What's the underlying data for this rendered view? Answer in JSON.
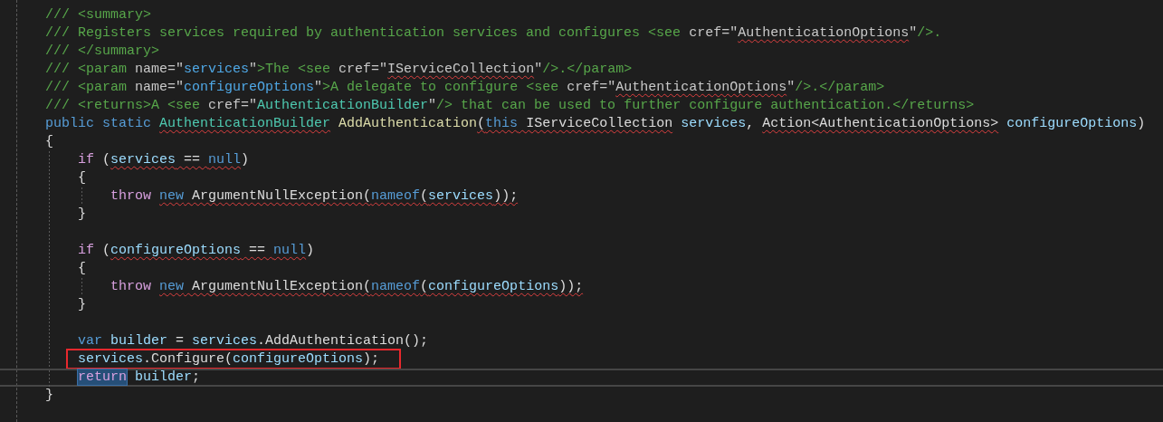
{
  "editor": {
    "lines": [
      {
        "current": false,
        "boxed": false,
        "tokens": [
          {
            "text": "/// <summary>",
            "kind": "comment",
            "error": false,
            "selected": false
          }
        ]
      },
      {
        "current": false,
        "boxed": false,
        "tokens": [
          {
            "text": "/// Registers services required by authentication services and configures <see ",
            "kind": "comment",
            "error": false,
            "selected": false
          },
          {
            "text": "cref=\"",
            "kind": "docattr",
            "error": false,
            "selected": false
          },
          {
            "text": "AuthenticationOptions",
            "kind": "docattr",
            "error": true,
            "selected": false
          },
          {
            "text": "\"",
            "kind": "docattr",
            "error": false,
            "selected": false
          },
          {
            "text": "/>.",
            "kind": "comment",
            "error": false,
            "selected": false
          }
        ]
      },
      {
        "current": false,
        "boxed": false,
        "tokens": [
          {
            "text": "/// </summary>",
            "kind": "comment",
            "error": false,
            "selected": false
          }
        ]
      },
      {
        "current": false,
        "boxed": false,
        "tokens": [
          {
            "text": "/// <param ",
            "kind": "comment",
            "error": false,
            "selected": false
          },
          {
            "text": "name=\"",
            "kind": "docattr",
            "error": false,
            "selected": false
          },
          {
            "text": "services",
            "kind": "docname",
            "error": false,
            "selected": false
          },
          {
            "text": "\"",
            "kind": "docattr",
            "error": false,
            "selected": false
          },
          {
            "text": ">The <see ",
            "kind": "comment",
            "error": false,
            "selected": false
          },
          {
            "text": "cref=\"",
            "kind": "docattr",
            "error": false,
            "selected": false
          },
          {
            "text": "IServiceCollection",
            "kind": "docattr",
            "error": true,
            "selected": false
          },
          {
            "text": "\"",
            "kind": "docattr",
            "error": false,
            "selected": false
          },
          {
            "text": "/>.</param>",
            "kind": "comment",
            "error": false,
            "selected": false
          }
        ]
      },
      {
        "current": false,
        "boxed": false,
        "tokens": [
          {
            "text": "/// <param ",
            "kind": "comment",
            "error": false,
            "selected": false
          },
          {
            "text": "name=\"",
            "kind": "docattr",
            "error": false,
            "selected": false
          },
          {
            "text": "configureOptions",
            "kind": "docname",
            "error": false,
            "selected": false
          },
          {
            "text": "\"",
            "kind": "docattr",
            "error": false,
            "selected": false
          },
          {
            "text": ">A delegate to configure <see ",
            "kind": "comment",
            "error": false,
            "selected": false
          },
          {
            "text": "cref=\"",
            "kind": "docattr",
            "error": false,
            "selected": false
          },
          {
            "text": "AuthenticationOptions",
            "kind": "docattr",
            "error": true,
            "selected": false
          },
          {
            "text": "\"",
            "kind": "docattr",
            "error": false,
            "selected": false
          },
          {
            "text": "/>.</param>",
            "kind": "comment",
            "error": false,
            "selected": false
          }
        ]
      },
      {
        "current": false,
        "boxed": false,
        "tokens": [
          {
            "text": "/// <returns>A <see ",
            "kind": "comment",
            "error": false,
            "selected": false
          },
          {
            "text": "cref=\"",
            "kind": "docattr",
            "error": false,
            "selected": false
          },
          {
            "text": "AuthenticationBuilder",
            "kind": "doctype",
            "error": false,
            "selected": false
          },
          {
            "text": "\"",
            "kind": "docattr",
            "error": false,
            "selected": false
          },
          {
            "text": "/> that can be used to further configure authentication.</returns>",
            "kind": "comment",
            "error": false,
            "selected": false
          }
        ]
      },
      {
        "current": false,
        "boxed": false,
        "tokens": [
          {
            "text": "public static ",
            "kind": "keyword",
            "error": false,
            "selected": false
          },
          {
            "text": "AuthenticationBuilder",
            "kind": "type",
            "error": true,
            "selected": false
          },
          {
            "text": " AddAuthentication",
            "kind": "method",
            "error": false,
            "selected": false
          },
          {
            "text": "(",
            "kind": "plain",
            "error": true,
            "selected": false
          },
          {
            "text": "this",
            "kind": "keyword",
            "error": true,
            "selected": false
          },
          {
            "text": " IServiceCollection",
            "kind": "plain",
            "error": true,
            "selected": false
          },
          {
            "text": " services",
            "kind": "param",
            "error": false,
            "selected": false
          },
          {
            "text": ", ",
            "kind": "plain",
            "error": false,
            "selected": false
          },
          {
            "text": "Action<AuthenticationOptions>",
            "kind": "plain",
            "error": true,
            "selected": false
          },
          {
            "text": " configureOptions",
            "kind": "param",
            "error": false,
            "selected": false
          },
          {
            "text": ")",
            "kind": "plain",
            "error": false,
            "selected": false
          }
        ]
      },
      {
        "current": false,
        "boxed": false,
        "tokens": [
          {
            "text": "{",
            "kind": "plain",
            "error": false,
            "selected": false
          }
        ]
      },
      {
        "current": false,
        "boxed": false,
        "tokens": [
          {
            "text": "    if",
            "kind": "control",
            "error": false,
            "selected": false
          },
          {
            "text": " (",
            "kind": "plain",
            "error": false,
            "selected": false
          },
          {
            "text": "services",
            "kind": "param",
            "error": true,
            "selected": false
          },
          {
            "text": " == ",
            "kind": "plain",
            "error": true,
            "selected": false
          },
          {
            "text": "null",
            "kind": "keyword",
            "error": true,
            "selected": false
          },
          {
            "text": ")",
            "kind": "plain",
            "error": false,
            "selected": false
          }
        ]
      },
      {
        "current": false,
        "boxed": false,
        "tokens": [
          {
            "text": "    {",
            "kind": "plain",
            "error": false,
            "selected": false
          }
        ]
      },
      {
        "current": false,
        "boxed": false,
        "tokens": [
          {
            "text": "        throw ",
            "kind": "control",
            "error": false,
            "selected": false
          },
          {
            "text": "new",
            "kind": "keyword",
            "error": true,
            "selected": false
          },
          {
            "text": " ArgumentNullException(",
            "kind": "plain",
            "error": true,
            "selected": false
          },
          {
            "text": "nameof",
            "kind": "keyword",
            "error": true,
            "selected": false
          },
          {
            "text": "(",
            "kind": "plain",
            "error": true,
            "selected": false
          },
          {
            "text": "services",
            "kind": "param",
            "error": true,
            "selected": false
          },
          {
            "text": "));",
            "kind": "plain",
            "error": true,
            "selected": false
          }
        ]
      },
      {
        "current": false,
        "boxed": false,
        "tokens": [
          {
            "text": "    }",
            "kind": "plain",
            "error": false,
            "selected": false
          }
        ]
      },
      {
        "current": false,
        "boxed": false
      },
      {
        "current": false,
        "boxed": false,
        "tokens": [
          {
            "text": "    if",
            "kind": "control",
            "error": false,
            "selected": false
          },
          {
            "text": " (",
            "kind": "plain",
            "error": false,
            "selected": false
          },
          {
            "text": "configureOptions",
            "kind": "param",
            "error": true,
            "selected": false
          },
          {
            "text": " == ",
            "kind": "plain",
            "error": true,
            "selected": false
          },
          {
            "text": "null",
            "kind": "keyword",
            "error": true,
            "selected": false
          },
          {
            "text": ")",
            "kind": "plain",
            "error": false,
            "selected": false
          }
        ]
      },
      {
        "current": false,
        "boxed": false,
        "tokens": [
          {
            "text": "    {",
            "kind": "plain",
            "error": false,
            "selected": false
          }
        ]
      },
      {
        "current": false,
        "boxed": false,
        "tokens": [
          {
            "text": "        throw ",
            "kind": "control",
            "error": false,
            "selected": false
          },
          {
            "text": "new",
            "kind": "keyword",
            "error": true,
            "selected": false
          },
          {
            "text": " ArgumentNullException(",
            "kind": "plain",
            "error": true,
            "selected": false
          },
          {
            "text": "nameof",
            "kind": "keyword",
            "error": true,
            "selected": false
          },
          {
            "text": "(",
            "kind": "plain",
            "error": true,
            "selected": false
          },
          {
            "text": "configureOptions",
            "kind": "param",
            "error": true,
            "selected": false
          },
          {
            "text": "));",
            "kind": "plain",
            "error": true,
            "selected": false
          }
        ]
      },
      {
        "current": false,
        "boxed": false,
        "tokens": [
          {
            "text": "    }",
            "kind": "plain",
            "error": false,
            "selected": false
          }
        ]
      },
      {
        "current": false,
        "boxed": false
      },
      {
        "current": false,
        "boxed": false,
        "tokens": [
          {
            "text": "    var ",
            "kind": "keyword",
            "error": false,
            "selected": false
          },
          {
            "text": "builder",
            "kind": "param",
            "error": false,
            "selected": false
          },
          {
            "text": " = ",
            "kind": "plain",
            "error": false,
            "selected": false
          },
          {
            "text": "services",
            "kind": "param",
            "error": false,
            "selected": false
          },
          {
            "text": ".AddAuthentication();",
            "kind": "plain",
            "error": false,
            "selected": false
          }
        ]
      },
      {
        "current": false,
        "boxed": true,
        "tokens": [
          {
            "text": "    services",
            "kind": "param",
            "error": false,
            "selected": false
          },
          {
            "text": ".Configure(",
            "kind": "plain",
            "error": false,
            "selected": false
          },
          {
            "text": "configureOptions",
            "kind": "param",
            "error": false,
            "selected": false
          },
          {
            "text": ");",
            "kind": "plain",
            "error": false,
            "selected": false
          }
        ]
      },
      {
        "current": true,
        "boxed": false,
        "tokens": [
          {
            "text": "    return",
            "kind": "control",
            "error": false,
            "selected": true
          },
          {
            "text": " builder",
            "kind": "param",
            "error": false,
            "selected": false
          },
          {
            "text": ";",
            "kind": "plain",
            "error": false,
            "selected": false
          }
        ]
      },
      {
        "current": false,
        "boxed": false,
        "tokens": [
          {
            "text": "}",
            "kind": "plain",
            "error": false,
            "selected": false
          }
        ]
      }
    ]
  }
}
